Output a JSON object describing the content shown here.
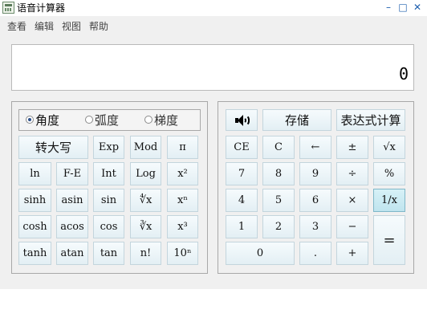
{
  "window": {
    "title": "语音计算器"
  },
  "menu": {
    "items": [
      "查看",
      "编辑",
      "视图",
      "帮助"
    ]
  },
  "display": {
    "value": "0"
  },
  "angle_mode": {
    "options": [
      "角度",
      "弧度",
      "梯度"
    ],
    "selected": "角度"
  },
  "sci_buttons": [
    [
      "转大写",
      "Exp",
      "Mod",
      "π"
    ],
    [
      "ln",
      "F-E",
      "Int",
      "Log",
      "x²"
    ],
    [
      "sinh",
      "asin",
      "sin",
      "∜x",
      "xⁿ"
    ],
    [
      "cosh",
      "acos",
      "cos",
      "∛x",
      "x³"
    ],
    [
      "tanh",
      "atan",
      "tan",
      "n!",
      "10ⁿ"
    ]
  ],
  "std_buttons": {
    "speaker_icon": "speaker-icon",
    "store_label": "存储",
    "expr_label": "表达式计算",
    "row1": [
      "CE",
      "C",
      "←",
      "±",
      "√x"
    ],
    "row2": [
      "7",
      "8",
      "9",
      "÷",
      "%"
    ],
    "row3": [
      "4",
      "5",
      "6",
      "×",
      "1/x"
    ],
    "row4": [
      "1",
      "2",
      "3",
      "−"
    ],
    "row5": [
      "0",
      ".",
      "+"
    ],
    "equals": "="
  },
  "colors": {
    "active_button": "#bfe4ee",
    "button_border": "#c3d5dd",
    "window_bg": "#f0f0f0"
  }
}
